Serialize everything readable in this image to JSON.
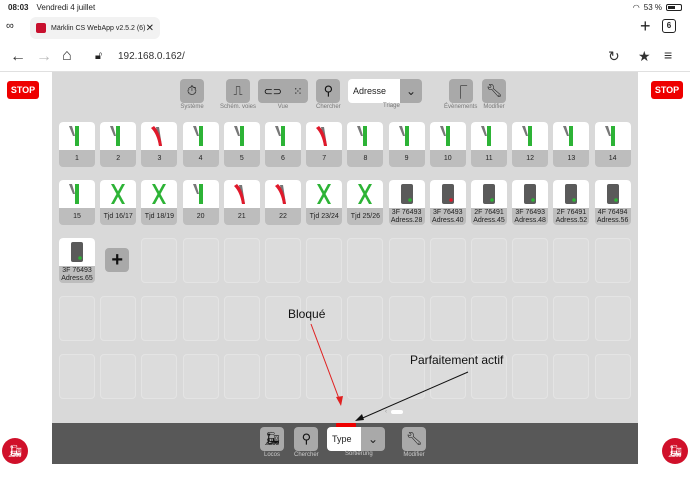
{
  "statusbar": {
    "time": "08:03",
    "date": "Vendredi 4 juillet",
    "battery": "53 %"
  },
  "tab": {
    "title": "Märklin CS WebApp v2.5.2 (6)",
    "close": "✕",
    "count": "6"
  },
  "address": {
    "url": "192.168.0.162/"
  },
  "stop_label": "STOP",
  "toolbar": {
    "systeme": "Système",
    "schem_voies": "Schém. voies",
    "vue": "Vue",
    "chercher": "Chercher",
    "adresse": "Adresse",
    "triage": "Triage",
    "evenements": "Évènements",
    "modifier": "Modifier"
  },
  "tiles": [
    {
      "label": "1",
      "kind": "turnout",
      "state": "green"
    },
    {
      "label": "2",
      "kind": "turnout",
      "state": "green"
    },
    {
      "label": "3",
      "kind": "turnout",
      "state": "red"
    },
    {
      "label": "4",
      "kind": "turnout",
      "state": "green"
    },
    {
      "label": "5",
      "kind": "turnout",
      "state": "green"
    },
    {
      "label": "6",
      "kind": "turnout",
      "state": "green"
    },
    {
      "label": "7",
      "kind": "turnout",
      "state": "red"
    },
    {
      "label": "8",
      "kind": "turnout",
      "state": "green"
    },
    {
      "label": "9",
      "kind": "turnout",
      "state": "green"
    },
    {
      "label": "10",
      "kind": "turnout",
      "state": "green"
    },
    {
      "label": "11",
      "kind": "turnout",
      "state": "green"
    },
    {
      "label": "12",
      "kind": "turnout",
      "state": "green"
    },
    {
      "label": "13",
      "kind": "turnout",
      "state": "green"
    },
    {
      "label": "14",
      "kind": "turnout",
      "state": "green"
    },
    {
      "label": "15",
      "kind": "turnout",
      "state": "green"
    },
    {
      "label": "Tjd 16/17",
      "kind": "cross",
      "state": "green"
    },
    {
      "label": "Tjd 18/19",
      "kind": "cross",
      "state": "green"
    },
    {
      "label": "20",
      "kind": "turnout",
      "state": "green"
    },
    {
      "label": "21",
      "kind": "turnout",
      "state": "red"
    },
    {
      "label": "22",
      "kind": "turnout",
      "state": "red"
    },
    {
      "label": "Tjd 23/24",
      "kind": "cross",
      "state": "green"
    },
    {
      "label": "Tjd 25/26",
      "kind": "cross",
      "state": "green"
    },
    {
      "label": "3F 76493 Adress.28",
      "kind": "signal",
      "state": "green"
    },
    {
      "label": "3F 76493 Adress.40",
      "kind": "signal",
      "state": "red"
    },
    {
      "label": "2F 76491 Adress.45",
      "kind": "signal",
      "state": "green"
    },
    {
      "label": "3F 76493 Adress.48",
      "kind": "signal",
      "state": "green"
    },
    {
      "label": "2F 76491 Adress.52",
      "kind": "signal",
      "state": "green"
    },
    {
      "label": "4F 76494 Adress.56",
      "kind": "signal",
      "state": "green"
    },
    {
      "label": "3F 76493 Adress.65",
      "kind": "signal",
      "state": "green"
    }
  ],
  "add_label": "+",
  "bottombar": {
    "locos": "Locos",
    "chercher": "Chercher",
    "type": "Type",
    "sortierung": "Sortierung",
    "modifier": "Modifier"
  },
  "annotations": {
    "bloque": "Bloqué",
    "actif": "Parfaitement actif"
  },
  "colors": {
    "green": "#2db336",
    "red": "#e0192b",
    "gray": "#777777"
  }
}
